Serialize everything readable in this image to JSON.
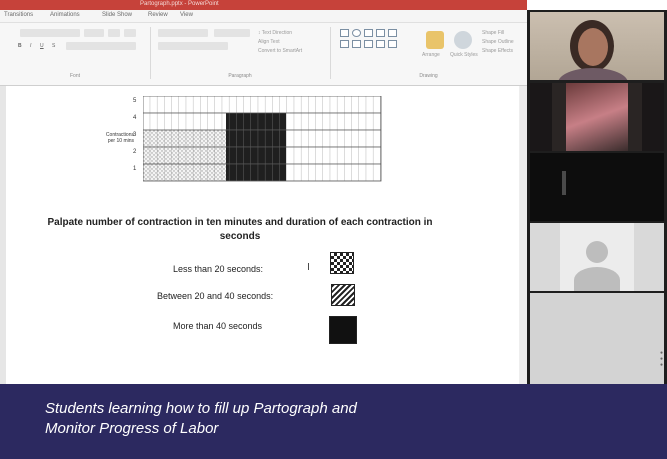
{
  "window": {
    "title": "Partograph.pptx - PowerPoint"
  },
  "menu": {
    "tabs": [
      "Transitions",
      "Animations",
      "Slide Show",
      "Review",
      "View"
    ]
  },
  "ribbon": {
    "groups": [
      "Font",
      "Paragraph",
      "Drawing"
    ],
    "align_text_label": "Align Text",
    "convert_smartart_label": "Convert to SmartArt",
    "arrange_label": "Arrange",
    "quick_styles_label": "Quick Styles",
    "shape_fill_label": "Shape Fill",
    "shape_outline_label": "Shape Outline",
    "shape_effects_label": "Shape Effects"
  },
  "slide": {
    "y_axis_label": "Contractions per 10 mins",
    "y_ticks": [
      "5",
      "4",
      "3",
      "2",
      "1"
    ],
    "heading": "Palpate number of contraction in ten minutes and duration of each contraction in seconds",
    "legend": [
      {
        "label": "Less than 20 seconds:",
        "pattern": "checker"
      },
      {
        "label": "Between 20 and 40 seconds:",
        "pattern": "diagonal-stripes"
      },
      {
        "label": "More than 40 seconds",
        "pattern": "solid"
      }
    ]
  },
  "participants": [
    "participant-1",
    "participant-2",
    "participant-3",
    "participant-4",
    "participant-5"
  ],
  "caption": {
    "line1": "Students learning how to fill up Partograph and",
    "line2": "Monitor Progress of Labor"
  },
  "colors": {
    "titlebar": "#c6423a",
    "caption_bg": "#2c2960",
    "caption_text": "#ffffff"
  }
}
